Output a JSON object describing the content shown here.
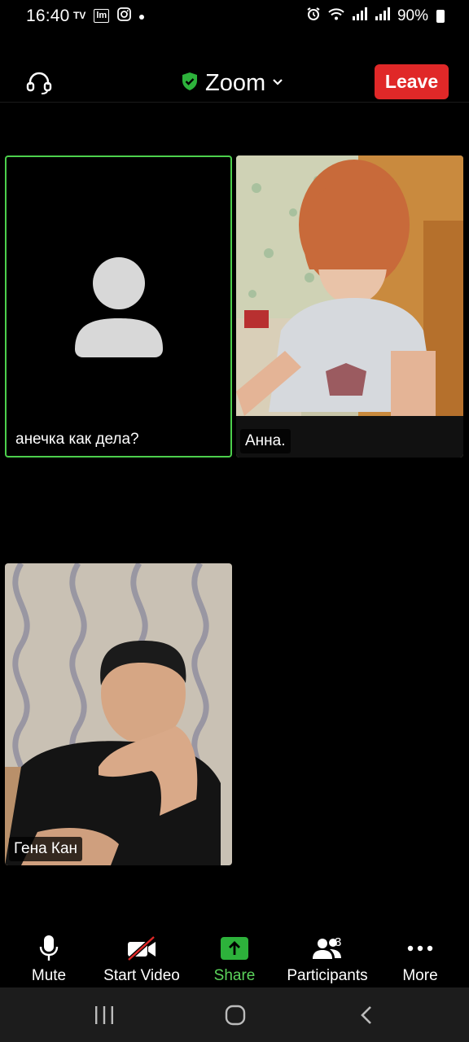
{
  "status_bar": {
    "time": "16:40",
    "battery": "90%"
  },
  "header": {
    "title": "Zoom",
    "leave_label": "Leave"
  },
  "tiles": [
    {
      "name": "анечка как дела?"
    },
    {
      "name": "Анна."
    },
    {
      "name": "Гена Кан"
    }
  ],
  "toolbar": {
    "mute_label": "Mute",
    "start_video_label": "Start Video",
    "share_label": "Share",
    "participants_label": "Participants",
    "participants_count": "3",
    "more_label": "More"
  },
  "colors": {
    "leave": "#e02828",
    "active_speaker_border": "#4ccf4c",
    "share_green": "#2db23b",
    "shield_green": "#2db23b"
  },
  "icons": [
    "headphone-icon",
    "shield-check-icon",
    "chevron-down-icon",
    "microphone-icon",
    "video-off-icon",
    "share-arrow-icon",
    "participants-icon",
    "more-dots-icon"
  ]
}
